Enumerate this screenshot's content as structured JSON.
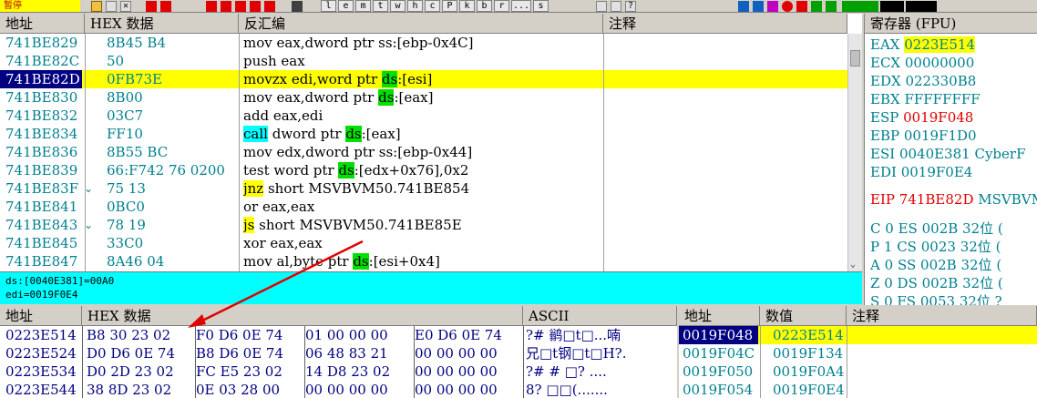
{
  "toolbar": {
    "status": "暂停",
    "letters": [
      "l",
      "e",
      "m",
      "t",
      "w",
      "h",
      "c",
      "P",
      "k",
      "b",
      "r",
      "...",
      "s"
    ]
  },
  "disasm": {
    "headers": {
      "addr": "地址",
      "hex": "HEX 数据",
      "asm": "反汇编",
      "comment": "注释"
    },
    "rows": [
      {
        "addr": "741BE829",
        "jmp": "",
        "hex": "8B45 B4",
        "asm": [
          {
            "t": "mov eax,dword ptr ss:[ebp-0x4C]"
          }
        ]
      },
      {
        "addr": "741BE82C",
        "jmp": "",
        "hex": "50",
        "asm": [
          {
            "t": "push eax"
          }
        ]
      },
      {
        "addr": "741BE82D",
        "jmp": "",
        "hex": "0FB73E",
        "asm": [
          {
            "t": "movzx edi,word ptr "
          },
          {
            "t": "ds",
            "c": "ds"
          },
          {
            "t": ":[esi]"
          }
        ]
      },
      {
        "addr": "741BE830",
        "jmp": "",
        "hex": "8B00",
        "asm": [
          {
            "t": "mov eax,dword ptr "
          },
          {
            "t": "ds",
            "c": "ds"
          },
          {
            "t": ":[eax]"
          }
        ]
      },
      {
        "addr": "741BE832",
        "jmp": "",
        "hex": "03C7",
        "asm": [
          {
            "t": "add eax,edi"
          }
        ]
      },
      {
        "addr": "741BE834",
        "jmp": "",
        "hex": "FF10",
        "asm": [
          {
            "t": "call",
            "c": "kw-cyan"
          },
          {
            "t": " dword ptr "
          },
          {
            "t": "ds",
            "c": "ds"
          },
          {
            "t": ":[eax]"
          }
        ]
      },
      {
        "addr": "741BE836",
        "jmp": "",
        "hex": "8B55 BC",
        "asm": [
          {
            "t": "mov edx,dword ptr ss:[ebp-0x44]"
          }
        ]
      },
      {
        "addr": "741BE839",
        "jmp": "",
        "hex": "66:F742 76 0200",
        "asm": [
          {
            "t": "test word ptr "
          },
          {
            "t": "ds",
            "c": "ds"
          },
          {
            "t": ":[edx+0x76],0x2"
          }
        ]
      },
      {
        "addr": "741BE83F",
        "jmp": "⌄",
        "hex": "75 13",
        "asm": [
          {
            "t": "jnz",
            "c": "kw-yel"
          },
          {
            "t": " short MSVBVM50.741BE854"
          }
        ]
      },
      {
        "addr": "741BE841",
        "jmp": "",
        "hex": "0BC0",
        "asm": [
          {
            "t": "or eax,eax"
          }
        ]
      },
      {
        "addr": "741BE843",
        "jmp": "⌄",
        "hex": "78 19",
        "asm": [
          {
            "t": "js",
            "c": "kw-yel"
          },
          {
            "t": " short MSVBVM50.741BE85E"
          }
        ]
      },
      {
        "addr": "741BE845",
        "jmp": "",
        "hex": "33C0",
        "asm": [
          {
            "t": "xor eax,eax"
          }
        ]
      },
      {
        "addr": "741BE847",
        "jmp": "",
        "hex": "8A46 04",
        "asm": [
          {
            "t": "mov al,byte ptr "
          },
          {
            "t": "ds",
            "c": "ds"
          },
          {
            "t": ":[esi+0x4]"
          }
        ]
      }
    ],
    "info1": "ds:[0040E381]=00A0",
    "info2": "edi=0019F0E4"
  },
  "registers": {
    "header": "寄存器 (FPU)",
    "rows": [
      {
        "name": "EAX",
        "val": "0223E514",
        "extra": "",
        "hl": true,
        "red": false
      },
      {
        "name": "ECX",
        "val": "00000000",
        "extra": "",
        "hl": false,
        "red": false
      },
      {
        "name": "EDX",
        "val": "022330B8",
        "extra": "",
        "hl": false,
        "red": false
      },
      {
        "name": "EBX",
        "val": "FFFFFFFF",
        "extra": "",
        "hl": false,
        "red": false
      },
      {
        "name": "ESP",
        "val": "0019F048",
        "extra": "",
        "hl": false,
        "red": true
      },
      {
        "name": "EBP",
        "val": "0019F1D0",
        "extra": "",
        "hl": false,
        "red": false
      },
      {
        "name": "ESI",
        "val": "0040E381",
        "extra": "CyberF",
        "hl": false,
        "red": false
      },
      {
        "name": "EDI",
        "val": "0019F0E4",
        "extra": "",
        "hl": false,
        "red": false
      }
    ],
    "eip": {
      "name": "EIP",
      "val": "741BE82D",
      "extra": "MSVBVM"
    },
    "flags": [
      {
        "f": "C",
        "v": "0",
        "seg": "ES",
        "sv": "002B",
        "bits": "32位 ("
      },
      {
        "f": "P",
        "v": "1",
        "seg": "CS",
        "sv": "0023",
        "bits": "32位 ("
      },
      {
        "f": "A",
        "v": "0",
        "seg": "SS",
        "sv": "002B",
        "bits": "32位 ("
      },
      {
        "f": "Z",
        "v": "0",
        "seg": "DS",
        "sv": "002B",
        "bits": "32位 ("
      },
      {
        "f": "S",
        "v": "0",
        "seg": "FS",
        "sv": "0053",
        "bits": "32位 ?"
      }
    ]
  },
  "dump": {
    "headers": {
      "addr": "地址",
      "hex": "HEX 数据",
      "ascii": "ASCII"
    },
    "rows": [
      {
        "addr": "0223E514",
        "g1": "B8 30 23 02",
        "g2": "F0 D6 0E 74",
        "g3": "01 00 00 00",
        "g4": "E0 D6 0E 74",
        "ascii": "?# 鹟□t□...喃"
      },
      {
        "addr": "0223E524",
        "g1": "D0 D6 0E 74",
        "g2": "B8 D6 0E 74",
        "g3": "06 48 83 21",
        "g4": "00 00 00 00",
        "ascii": "兄□t钢□t□H?."
      },
      {
        "addr": "0223E534",
        "g1": "D0 2D 23 02",
        "g2": "FC E5 23 02",
        "g3": "14 D8 23 02",
        "g4": "00 00 00 00",
        "ascii": "?#   # □? ...."
      },
      {
        "addr": "0223E544",
        "g1": "38 8D 23 02",
        "g2": "0E 03 28 00",
        "g3": "00 00 00 00",
        "g4": "00 00 00 00",
        "ascii": "8? □□(......."
      }
    ]
  },
  "stack": {
    "headers": {
      "addr": "地址",
      "val": "数值",
      "comment": "注释"
    },
    "rows": [
      {
        "addr": "0019F048",
        "val": "0223E514",
        "sel": true
      },
      {
        "addr": "0019F04C",
        "val": "0019F134",
        "sel": false
      },
      {
        "addr": "0019F050",
        "val": "0019F0A4",
        "sel": false
      },
      {
        "addr": "0019F054",
        "val": "0019F0E4",
        "sel": false
      }
    ]
  }
}
